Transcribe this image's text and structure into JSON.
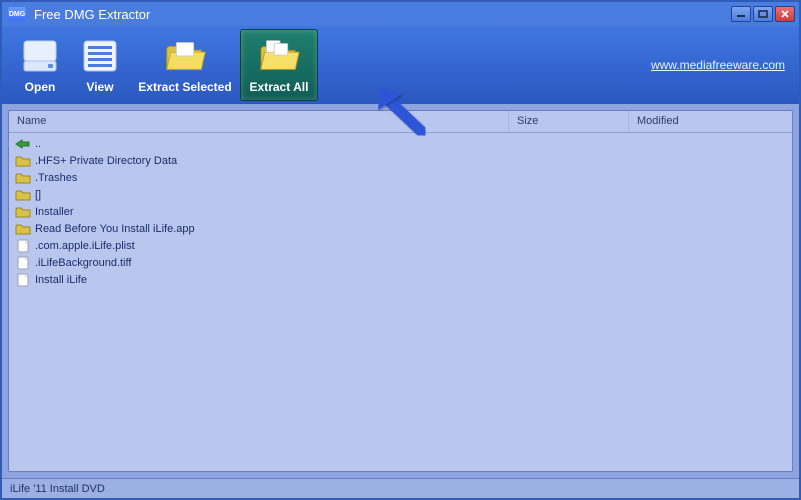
{
  "window": {
    "title": "Free DMG Extractor",
    "logo_text": "DMG"
  },
  "toolbar": {
    "open_label": "Open",
    "view_label": "View",
    "extract_selected_label": "Extract Selected",
    "extract_all_label": "Extract All",
    "url_text": "www.mediafreeware.com"
  },
  "columns": {
    "name": "Name",
    "size": "Size",
    "modified": "Modified"
  },
  "rows": [
    {
      "kind": "up",
      "name": ".."
    },
    {
      "kind": "folder",
      "name": ".HFS+ Private Directory Data"
    },
    {
      "kind": "folder",
      "name": ".Trashes"
    },
    {
      "kind": "folder",
      "name": "[]"
    },
    {
      "kind": "folder",
      "name": "Installer"
    },
    {
      "kind": "folder",
      "name": "Read Before You Install iLife.app"
    },
    {
      "kind": "file",
      "name": ".com.apple.iLife.plist"
    },
    {
      "kind": "file",
      "name": ".iLifeBackground.tiff"
    },
    {
      "kind": "file",
      "name": "Install iLife"
    }
  ],
  "status": {
    "text": "iLife '11 Install DVD"
  }
}
